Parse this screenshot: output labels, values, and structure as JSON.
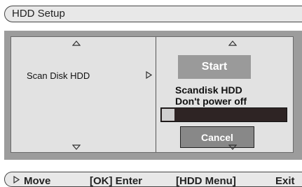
{
  "header": {
    "title": "HDD Setup"
  },
  "menu": {
    "items": [
      {
        "label": "Scan Disk HDD"
      }
    ]
  },
  "detail": {
    "start_label": "Start",
    "status_lines": [
      "Scandisk HDD",
      "Don't power off"
    ],
    "progress": 0.1,
    "cancel_label": "Cancel"
  },
  "footer": {
    "move_label": "Move",
    "enter_label": "[OK] Enter",
    "hdd_menu_label": "[HDD Menu]",
    "exit_label": "Exit"
  },
  "icons": {
    "scroll_up": "triangle-up-outline",
    "scroll_down": "triangle-down-outline",
    "submenu": "triangle-right-outline",
    "move": "triangle-right-outline"
  },
  "colors": {
    "panel_bg": "#9c9c9c",
    "inner_bg": "#e2e2e2",
    "button_bg": "#9a9a9a",
    "progress_track": "#2e2424",
    "progress_fill": "#d0d0d0"
  }
}
